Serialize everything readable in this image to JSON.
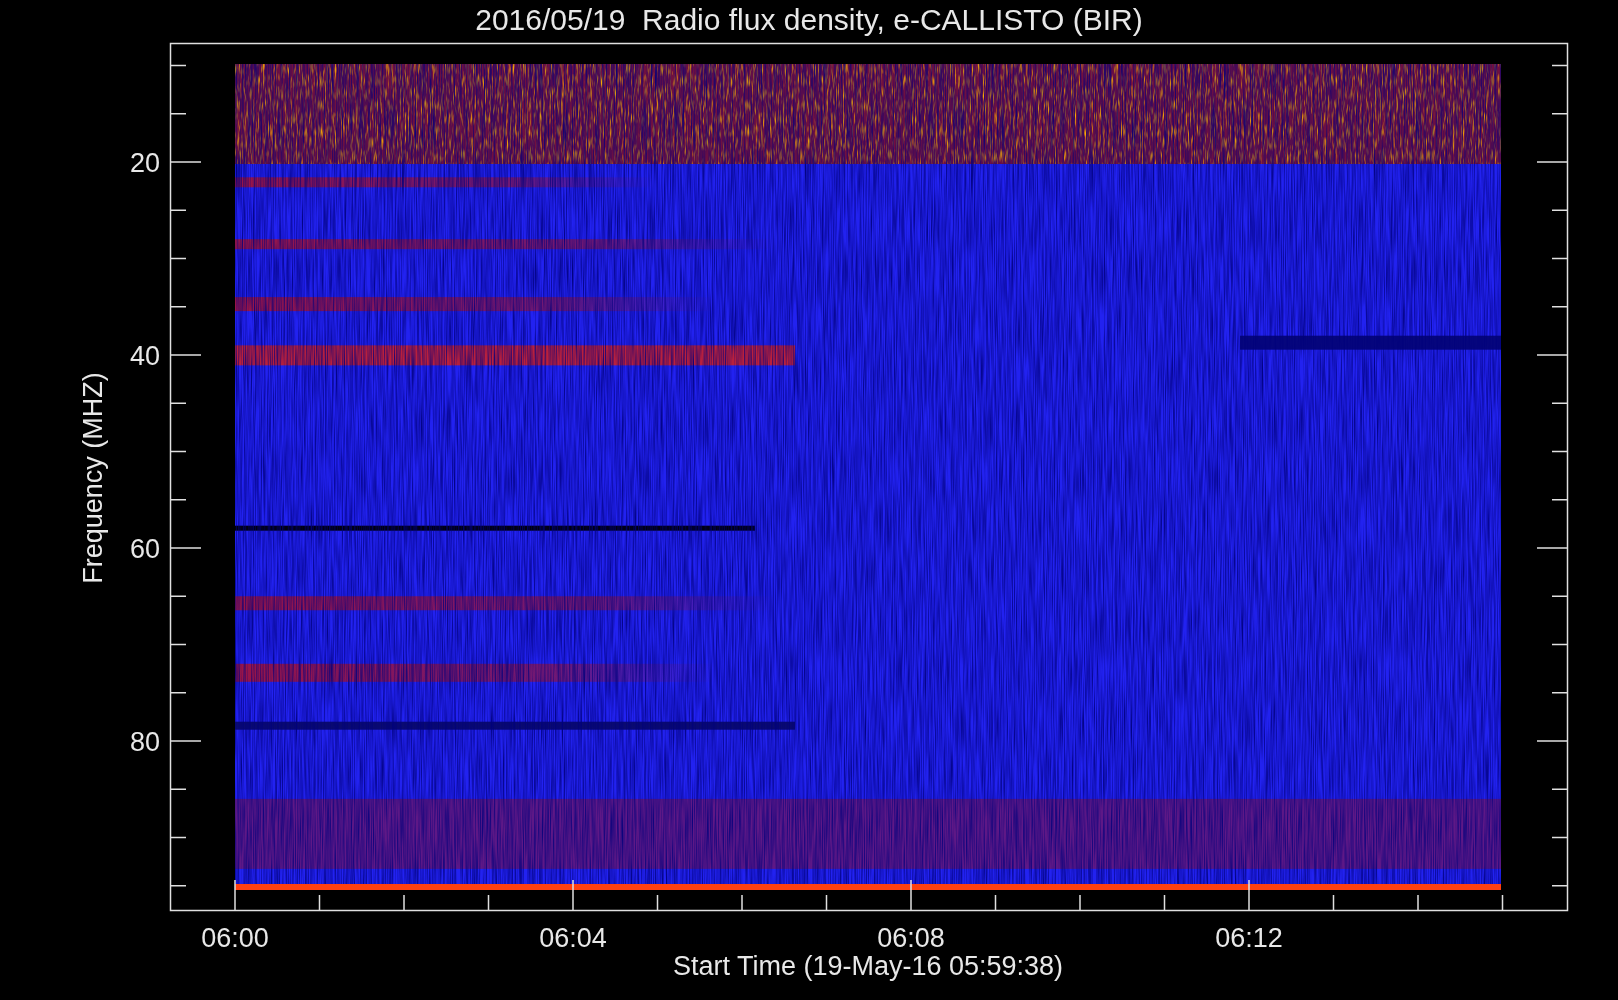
{
  "title": "2016/05/19  Radio flux density, e-CALLISTO (BIR)",
  "plot": {
    "ylabel": "Frequency (MHZ)",
    "xlabel": "Start Time (19-May-16 05:59:38)",
    "yticks": [
      "20",
      "40",
      "60",
      "80"
    ],
    "xticks": [
      "06:00",
      "06:04",
      "06:08",
      "06:12"
    ]
  }
}
